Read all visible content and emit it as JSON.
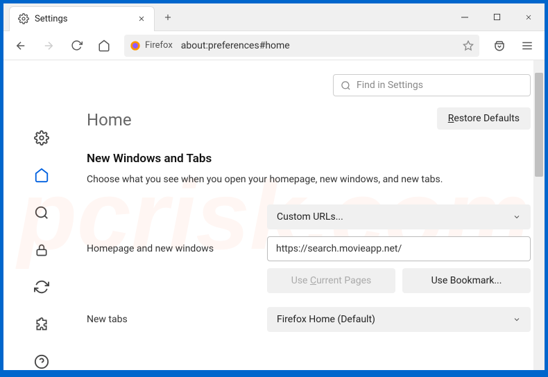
{
  "tab": {
    "title": "Settings"
  },
  "toolbar": {
    "firefox_label": "Firefox",
    "url": "about:preferences#home"
  },
  "search": {
    "placeholder": "Find in Settings"
  },
  "page": {
    "title": "Home",
    "restore_label": "Restore Defaults",
    "restore_underline": "R"
  },
  "section": {
    "title": "New Windows and Tabs",
    "description": "Choose what you see when you open your homepage, new windows, and new tabs."
  },
  "form": {
    "homepage_label": "Homepage and new windows",
    "newtabs_label": "New tabs",
    "homepage_dropdown": "Custom URLs...",
    "homepage_value": "https://search.movieapp.net/",
    "use_current_label": "Use Current Pages",
    "use_current_underline": "C",
    "use_bookmark_label": "Use Bookmark...",
    "newtabs_dropdown": "Firefox Home (Default)"
  }
}
